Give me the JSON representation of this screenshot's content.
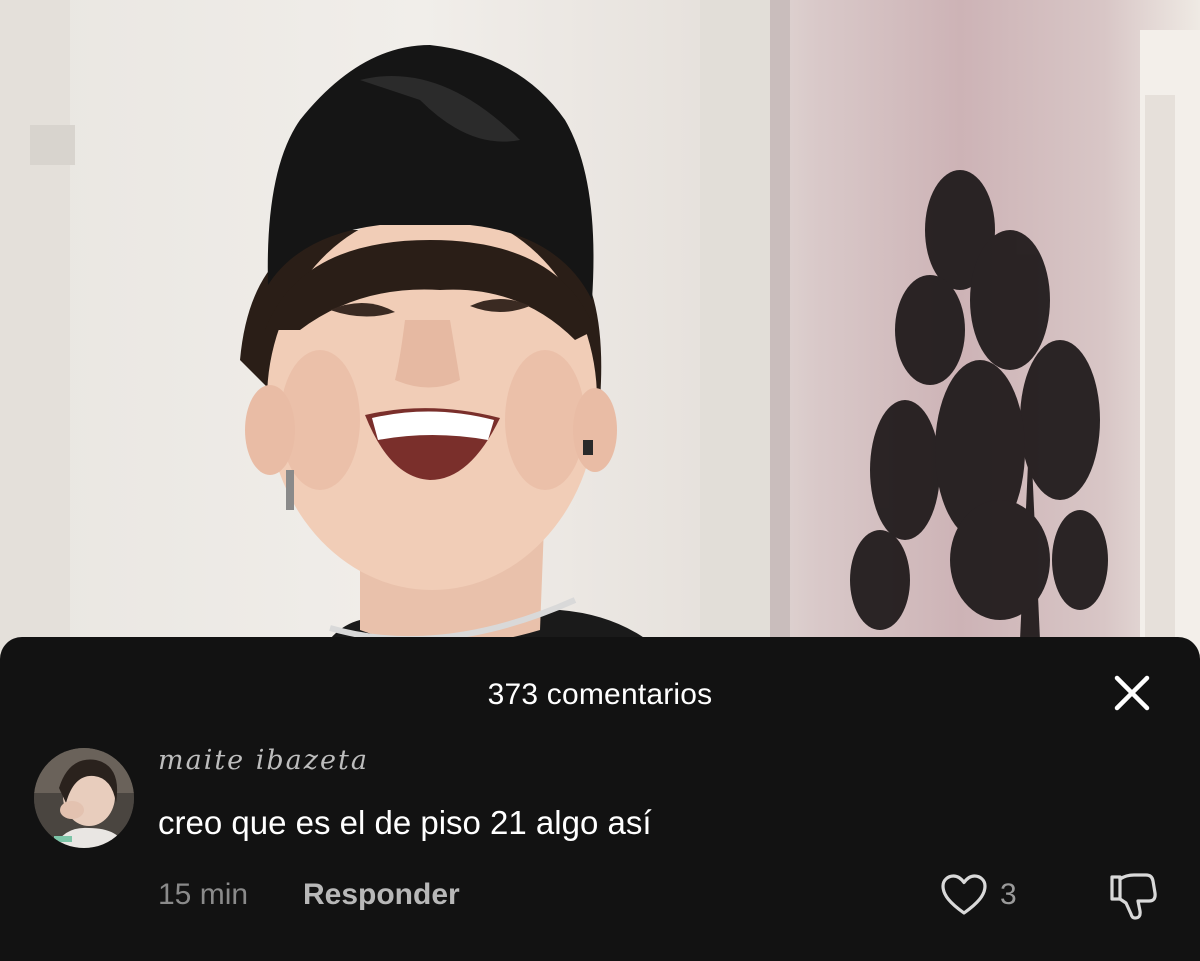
{
  "comments_panel": {
    "title": "373 comentarios",
    "close_icon": "close-icon"
  },
  "comment": {
    "author": "maite ibazeta",
    "text": "creo que es el de piso 21 algo así",
    "time": "15 min",
    "reply_label": "Responder",
    "like_count": "3",
    "like_icon": "heart-icon",
    "dislike_icon": "thumbs-down-icon"
  },
  "colors": {
    "sheet_background": "#121212",
    "primary_text": "#ffffff",
    "secondary_text": "#8a8a8a"
  }
}
